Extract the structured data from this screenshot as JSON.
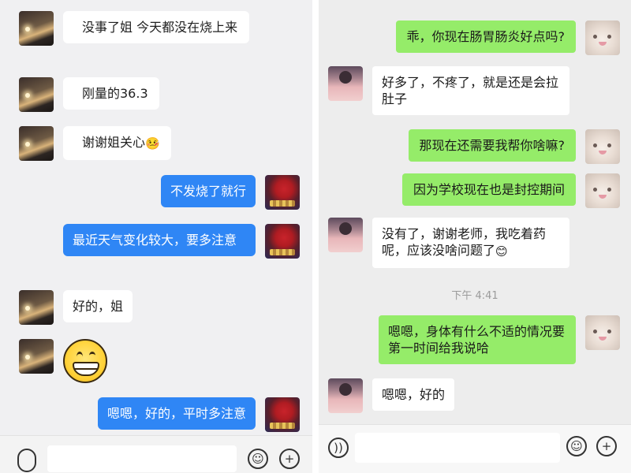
{
  "left_chat": {
    "messages": [
      {
        "direction": "in",
        "text": "没事了姐  今天都没在烧上来"
      },
      {
        "direction": "in",
        "text": "刚量的36.3"
      },
      {
        "direction": "in",
        "text": "谢谢姐关心",
        "emoji": "🤒"
      },
      {
        "direction": "out",
        "text": "不发烧了就行"
      },
      {
        "direction": "out",
        "text": "最近天气变化较大，要多注意"
      },
      {
        "direction": "in",
        "text": "好的，姐"
      },
      {
        "direction": "in",
        "sticker": "grinning-face-sticker"
      },
      {
        "direction": "out",
        "text": "嗯嗯，好的，平时多注意"
      }
    ],
    "input": {
      "voice_icon": "voice-icon",
      "emoji_icon": "emoji-icon",
      "plus_icon": "plus-icon"
    }
  },
  "right_chat": {
    "messages": [
      {
        "direction": "out",
        "text": "乖，你现在肠胃肠炎好点吗?"
      },
      {
        "direction": "in",
        "text": "好多了，不疼了，就是还是会拉肚子"
      },
      {
        "direction": "out",
        "text": "那现在还需要我帮你啥嘛?"
      },
      {
        "direction": "out",
        "text": "因为学校现在也是封控期间"
      },
      {
        "direction": "in",
        "text": "没有了，谢谢老师，我吃着药呢，应该没啥问题了",
        "emoji": "😊"
      },
      {
        "direction": "out",
        "text": "嗯嗯，身体有什么不适的情况要第一时间给我说哈"
      },
      {
        "direction": "in",
        "text": "嗯嗯，好的"
      }
    ],
    "timestamp": "下午 4:41",
    "input": {
      "voice_icon": "voice-icon",
      "emoji_icon": "emoji-icon",
      "plus_icon": "plus-icon"
    }
  },
  "colors": {
    "left_out_bubble": "#2f86f5",
    "right_out_bubble": "#95ec69",
    "in_bubble": "#ffffff"
  }
}
